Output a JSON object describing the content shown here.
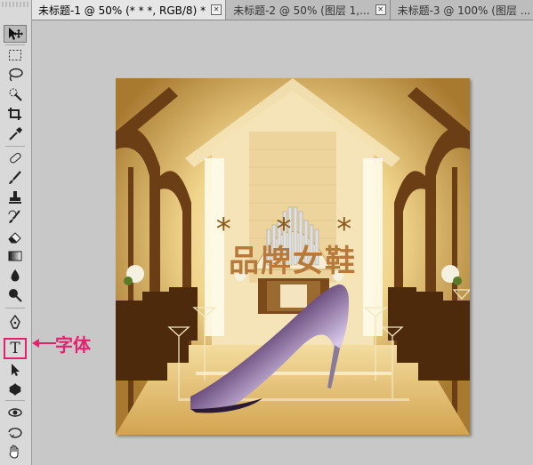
{
  "tabs": [
    {
      "label": "未标题-1 @ 50% (* * *, RGB/8) *",
      "active": true
    },
    {
      "label": "未标题-2 @ 50% (图层 1,...",
      "active": false
    },
    {
      "label": "未标题-3 @ 100% (图层 ...",
      "active": false
    }
  ],
  "close_glyph": "✕",
  "canvas": {
    "stars": "* * *",
    "brand_text": "品牌女鞋"
  },
  "annotation": {
    "label": "字体",
    "color": "#e3226f"
  },
  "tools": [
    "move-tool",
    "marquee-tool",
    "lasso-tool",
    "quick-selection-tool",
    "crop-tool",
    "eyedropper-tool",
    "spot-healing-tool",
    "brush-tool",
    "clone-stamp-tool",
    "history-brush-tool",
    "eraser-tool",
    "gradient-tool",
    "blur-tool",
    "dodge-tool",
    "pen-tool",
    "type-tool",
    "path-selection-tool",
    "custom-shape-tool",
    "3d-rotate-tool",
    "3d-orbit-tool",
    "hand-tool"
  ],
  "type_tool_glyph": "T"
}
